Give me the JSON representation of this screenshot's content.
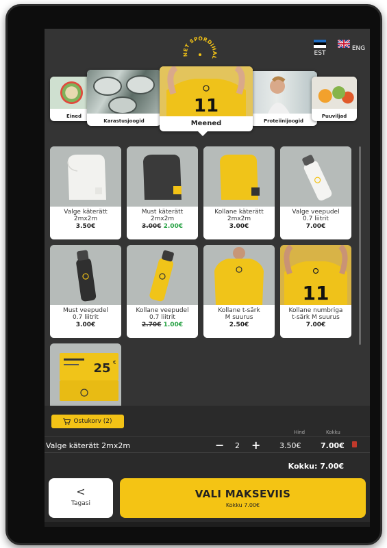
{
  "brand": {
    "logo_text": "NET SPORDIHALL",
    "accent": "#f3c316",
    "sale_color": "#27a244"
  },
  "languages": [
    {
      "code": "EST"
    },
    {
      "code": "ENG"
    }
  ],
  "categories": [
    {
      "label": "Eined"
    },
    {
      "label": "Karastusjoogid"
    },
    {
      "label": "Meened",
      "active": true
    },
    {
      "label": "Proteiinijoogid"
    },
    {
      "label": "Puuviljad"
    }
  ],
  "products": [
    {
      "name1": "Valge käterätt",
      "name2": "2mx2m",
      "price": "3.50€"
    },
    {
      "name1": "Must käterätt",
      "name2": "2mx2m",
      "old_price": "3.00€",
      "price": "2.00€"
    },
    {
      "name1": "Kollane käterätt",
      "name2": "2mx2m",
      "price": "3.00€"
    },
    {
      "name1": "Valge veepudel",
      "name2": "0.7 liitrit",
      "price": "7.00€"
    },
    {
      "name1": "Must veepudel",
      "name2": "0.7 liitrit",
      "price": "3.00€"
    },
    {
      "name1": "Kollane veepudel",
      "name2": "0.7 liitrit",
      "old_price": "2.70€",
      "price": "1.00€"
    },
    {
      "name1": "Kollane t-särk",
      "name2": "M suurus",
      "price": "2.50€"
    },
    {
      "name1": "Kollane numbriga",
      "name2": "t-särk M suurus",
      "price": "7.00€"
    },
    {
      "voucher_amount": "25"
    }
  ],
  "jersey_number": "11",
  "cart": {
    "button_label": "Ostukorv (2)",
    "col_price": "Hind",
    "col_total": "Kokku",
    "items": [
      {
        "name": "Valge käterätt 2mx2m",
        "qty": "2",
        "minus": "−",
        "plus": "+",
        "unit_price": "3.50€",
        "line_total": "7.00€"
      }
    ],
    "total_label": "Kokku: 7.00€"
  },
  "footer": {
    "back_chevron": "<",
    "back_label": "Tagasi",
    "pay_label": "VALI MAKSEVIIS",
    "pay_sub": "Kokku 7.00€"
  }
}
